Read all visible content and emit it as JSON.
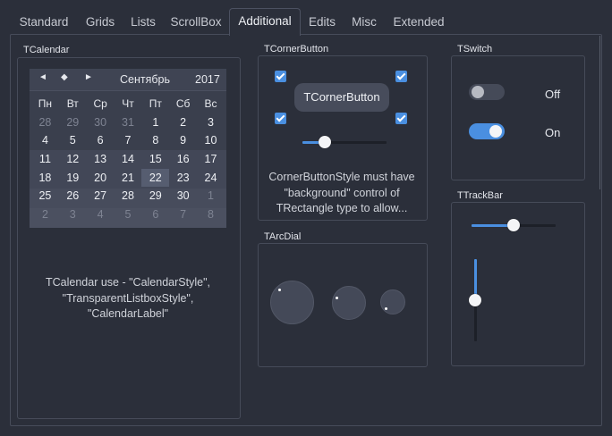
{
  "tabs": [
    {
      "label": "Standard"
    },
    {
      "label": "Grids"
    },
    {
      "label": "Lists"
    },
    {
      "label": "ScrollBox"
    },
    {
      "label": "Additional"
    },
    {
      "label": "Edits"
    },
    {
      "label": "Misc"
    },
    {
      "label": "Extended"
    }
  ],
  "active_tab": "Additional",
  "calendar_group": {
    "title": "TCalendar",
    "nav": {
      "prev": "◄",
      "today": "◆",
      "next": "►"
    },
    "month": "Сентябрь",
    "year": "2017",
    "weekdays": [
      "Пн",
      "Вт",
      "Ср",
      "Чт",
      "Пт",
      "Сб",
      "Вс"
    ],
    "weeks": [
      [
        "28",
        "29",
        "30",
        "31",
        "1",
        "2",
        "3"
      ],
      [
        "4",
        "5",
        "6",
        "7",
        "8",
        "9",
        "10"
      ],
      [
        "11",
        "12",
        "13",
        "14",
        "15",
        "16",
        "17"
      ],
      [
        "18",
        "19",
        "20",
        "21",
        "22",
        "23",
        "24"
      ],
      [
        "25",
        "26",
        "27",
        "28",
        "29",
        "30",
        "1"
      ],
      [
        "2",
        "3",
        "4",
        "5",
        "6",
        "7",
        "8"
      ]
    ],
    "selected_day": "22",
    "caption_lines": [
      "TCalendar use - \"CalendarStyle\",",
      "\"TransparentListboxStyle\",",
      "\"CalendarLabel\""
    ]
  },
  "corner_button_group": {
    "title": "TCornerButton",
    "button_label": "TCornerButton",
    "checkboxes": [
      true,
      true,
      true,
      true
    ],
    "slider_value": 0.27,
    "description_lines": [
      "CornerButtonStyle must have",
      "\"background\" control of",
      "TRectangle type to allow..."
    ]
  },
  "arcdial_group": {
    "title": "TArcDial"
  },
  "switch_group": {
    "title": "TSwitch",
    "switches": [
      {
        "state": false,
        "label": "Off"
      },
      {
        "state": true,
        "label": "On"
      }
    ]
  },
  "trackbar_group": {
    "title": "TTrackBar",
    "horizontal_value": 0.5,
    "vertical_value": 0.5
  },
  "colors": {
    "background": "#2b2f3a",
    "accent": "#4a8fe0",
    "border": "#464b59"
  }
}
